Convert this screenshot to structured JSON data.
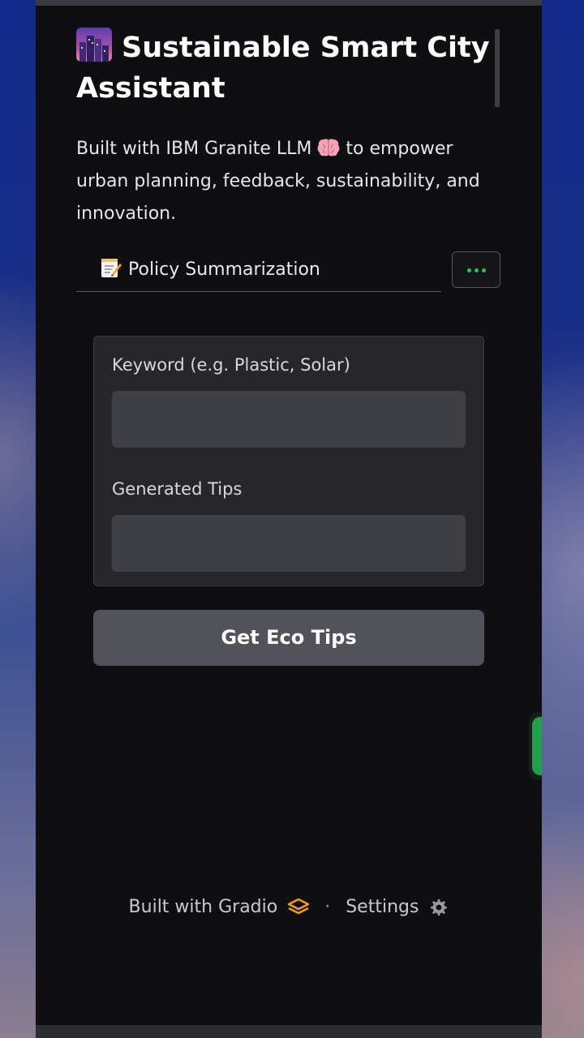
{
  "header": {
    "title": "Sustainable Smart City Assistant",
    "title_icon": "city-at-dusk-icon",
    "description_part1": "Built with IBM Granite LLM",
    "description_icon": "brain-icon",
    "description_part2": "to empower urban planning, feedback, sustainability, and innovation."
  },
  "tabs": {
    "active_label": "Policy Summarization",
    "active_icon": "memo-icon",
    "more_icon": "ellipsis-icon"
  },
  "form": {
    "keyword_label": "Keyword (e.g. Plastic, Solar)",
    "keyword_value": "",
    "tips_label": "Generated Tips",
    "tips_value": "",
    "submit_label": "Get Eco Tips"
  },
  "footer": {
    "built_with": "Built with Gradio",
    "separator": "·",
    "settings": "Settings"
  },
  "colors": {
    "page_bg": "#0f0f12",
    "panel_bg": "#27272a",
    "input_bg": "#3f3f46",
    "button_bg": "#52525b",
    "accent_green": "#22c55e",
    "gradio_orange": "#f59e0b"
  }
}
